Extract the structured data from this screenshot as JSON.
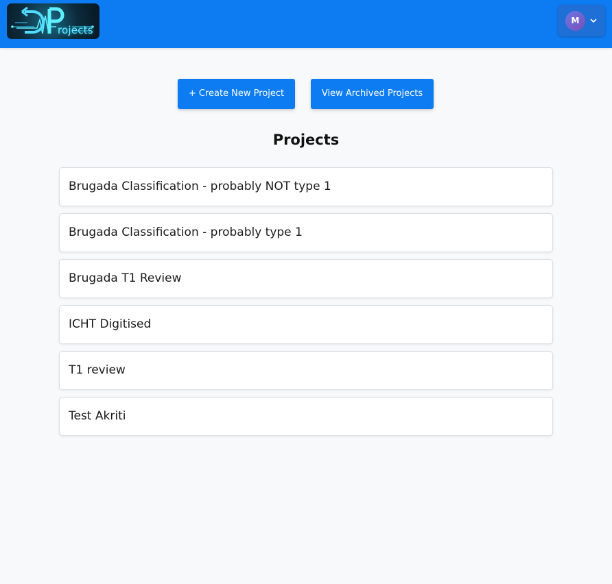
{
  "header": {
    "logo_text": "rojects",
    "user_initial": "M"
  },
  "actions": {
    "create_label": "+ Create New Project",
    "archived_label": "View Archived Projects"
  },
  "main": {
    "title": "Projects",
    "projects": [
      "Brugada Classification - probably NOT type 1",
      "Brugada Classification - probably type 1",
      "Brugada T1 Review",
      "ICHT Digitised",
      "T1 review",
      "Test Akriti"
    ]
  },
  "colors": {
    "primary": "#0d7cf2",
    "background": "#f8f9fa",
    "avatar": "#6a5acd"
  }
}
